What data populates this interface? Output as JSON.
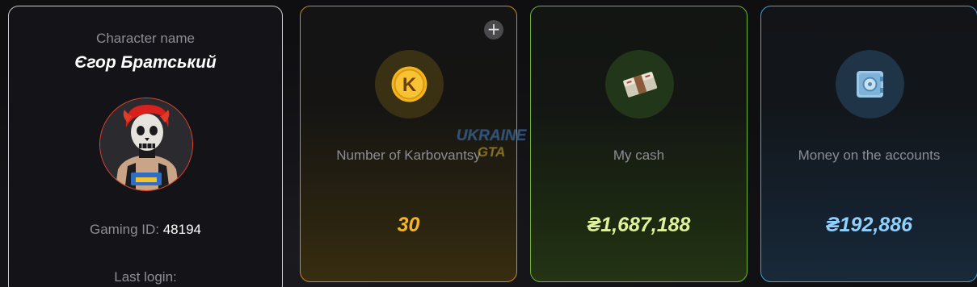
{
  "character": {
    "label": "Character name",
    "name": "Єгор Братський",
    "gaming_id_label": "Gaming ID:",
    "gaming_id": "48194",
    "last_login_label": "Last login:"
  },
  "stats": {
    "karbovantsy": {
      "label": "Number of Karbovantsy",
      "value": "30",
      "plus": "+",
      "icon": "karbovanets-coin-icon",
      "accent": "#f4b42a"
    },
    "cash": {
      "label": "My cash",
      "value": "₴1,687,188",
      "icon": "money-stack-icon",
      "accent": "#dff19a"
    },
    "accounts": {
      "label": "Money on the accounts",
      "value": "₴192,886",
      "icon": "safe-icon",
      "accent": "#8fd0ff"
    }
  },
  "watermark": {
    "line1": "UKRAINE",
    "line2": "GTA"
  }
}
